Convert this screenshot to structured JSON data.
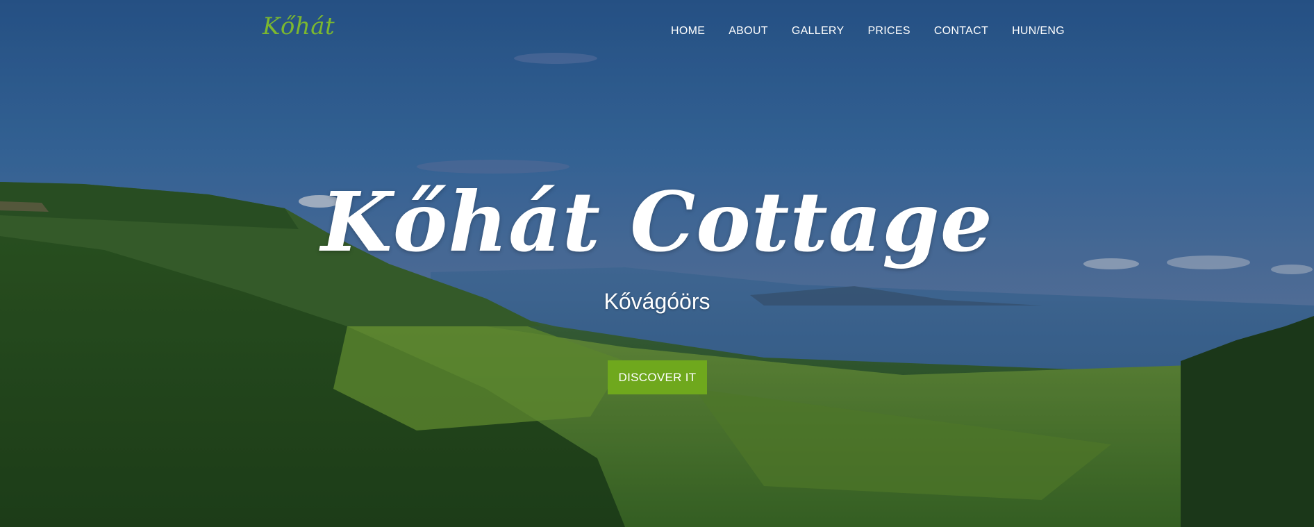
{
  "brand": {
    "logo": "Kőhát",
    "logo_color": "#7cb82f"
  },
  "nav": {
    "items": [
      {
        "label": "HOME"
      },
      {
        "label": "ABOUT"
      },
      {
        "label": "GALLERY"
      },
      {
        "label": "PRICES"
      },
      {
        "label": "CONTACT"
      },
      {
        "label": "HUN/ENG"
      }
    ]
  },
  "hero": {
    "title": "Kőhát Cottage",
    "subtitle": "Kővágóörs",
    "cta_label": "DISCOVER IT",
    "cta_color": "#6fa81d"
  }
}
